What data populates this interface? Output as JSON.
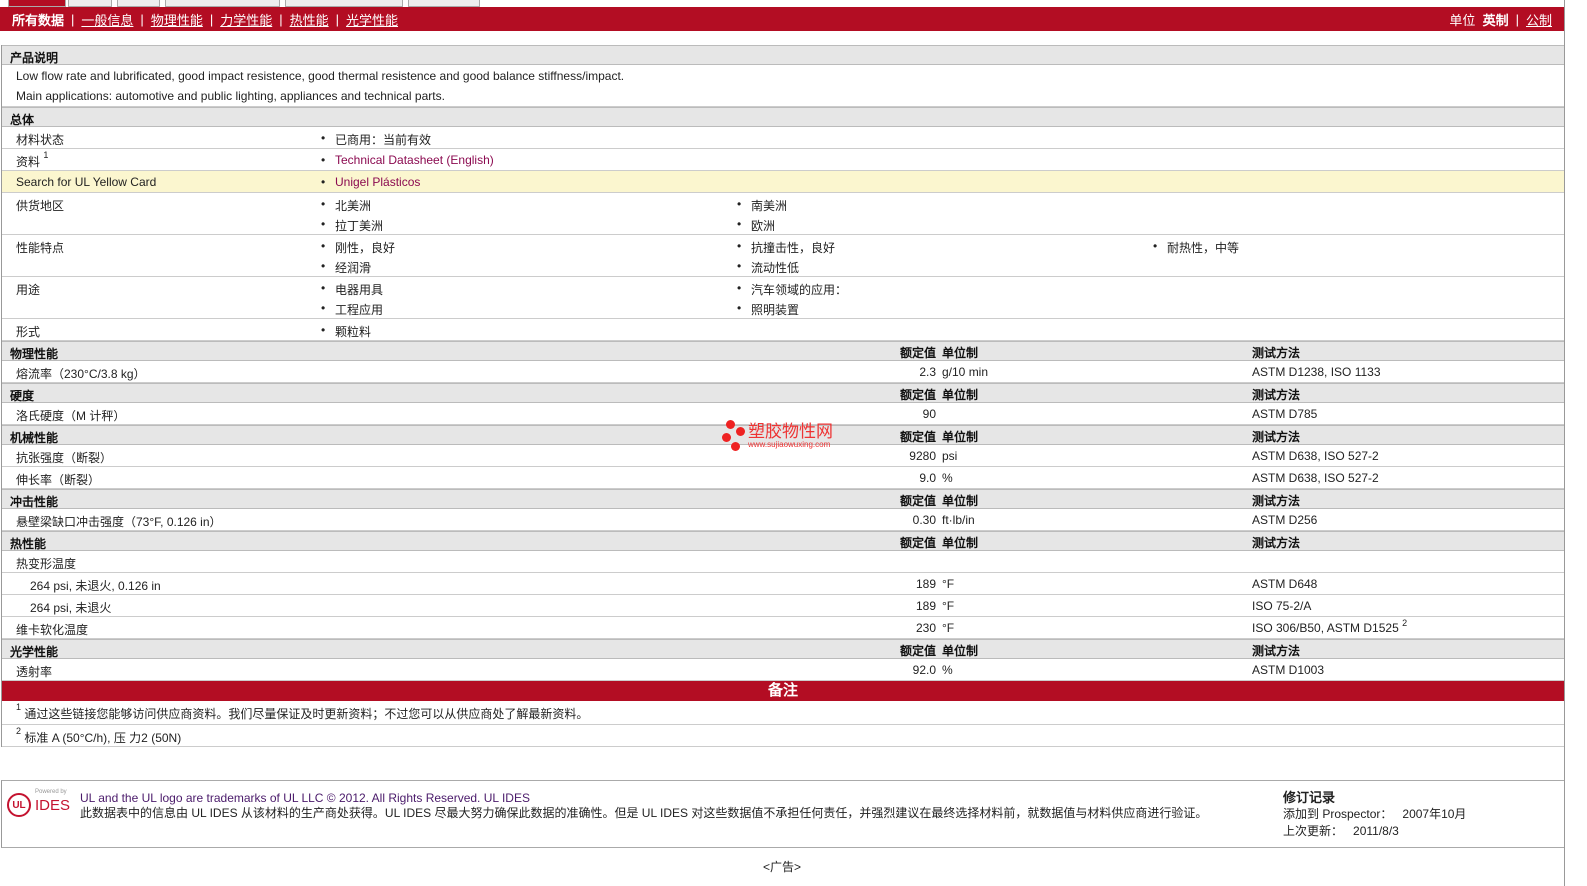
{
  "nav": {
    "all": "所有数据",
    "tabs": [
      "一般信息",
      "物理性能",
      "力学性能",
      "热性能",
      "光学性能"
    ],
    "units_label": "单位",
    "unit_selected": "英制",
    "unit_other": "公制"
  },
  "desc": {
    "title": "产品说明",
    "lines": [
      "Low flow rate and lubrificated, good impact resistence, good thermal resistence and good balance stiffness/impact.",
      "Main applications: automotive and public lighting, appliances and technical parts."
    ]
  },
  "general": {
    "title": "总体",
    "status": {
      "label": "材料状态",
      "value": "已商用：当前有效"
    },
    "docs": {
      "label": "资料",
      "sup": "1",
      "value": "Technical Datasheet (English)"
    },
    "yellow": {
      "label": "Search for UL Yellow Card",
      "value": "Unigel Plásticos"
    },
    "regions": {
      "label": "供货地区",
      "items": [
        "北美洲",
        "南美洲",
        "拉丁美洲",
        "欧洲"
      ]
    },
    "features": {
      "label": "性能特点",
      "items": [
        "刚性，良好",
        "抗撞击性，良好",
        "耐热性，中等",
        "经润滑",
        "流动性低"
      ]
    },
    "uses": {
      "label": "用途",
      "items": [
        "电器用具",
        "汽车领域的应用：",
        "工程应用",
        "照明装置"
      ]
    },
    "form": {
      "label": "形式",
      "items": [
        "颗粒料"
      ]
    }
  },
  "cols": {
    "value": "额定值",
    "unit": "单位制",
    "method": "测试方法"
  },
  "sections": {
    "physical": {
      "title": "物理性能",
      "rows": [
        {
          "name": "熔流率（230°C/3.8 kg）",
          "value": "2.3",
          "unit": "g/10 min",
          "method": "ASTM D1238, ISO 1133"
        }
      ]
    },
    "hardness": {
      "title": "硬度",
      "rows": [
        {
          "name": "洛氏硬度（M 计秤）",
          "value": "90",
          "unit": "",
          "method": "ASTM D785"
        }
      ]
    },
    "mechanical": {
      "title": "机械性能",
      "rows": [
        {
          "name": "抗张强度（断裂）",
          "value": "9280",
          "unit": "psi",
          "method": "ASTM D638, ISO 527-2"
        },
        {
          "name": "伸长率（断裂）",
          "value": "9.0",
          "unit": "%",
          "method": "ASTM D638, ISO 527-2"
        }
      ]
    },
    "impact": {
      "title": "冲击性能",
      "rows": [
        {
          "name": "悬壁梁缺口冲击强度（73°F, 0.126 in）",
          "value": "0.30",
          "unit": "ft·lb/in",
          "method": "ASTM D256"
        }
      ]
    },
    "thermal": {
      "title": "热性能",
      "hdt": "热变形温度",
      "rows": [
        {
          "name": "264 psi, 未退火, 0.126 in",
          "value": "189",
          "unit": "°F",
          "method": "ASTM D648"
        },
        {
          "name": "264 psi, 未退火",
          "value": "189",
          "unit": "°F",
          "method": "ISO 75-2/A"
        },
        {
          "name": "维卡软化温度",
          "value": "230",
          "unit": "°F",
          "method": "ISO 306/B50, ASTM D1525",
          "sup": "2"
        }
      ]
    },
    "optical": {
      "title": "光学性能",
      "rows": [
        {
          "name": "透射率",
          "value": "92.0",
          "unit": "%",
          "method": "ASTM D1003"
        }
      ]
    }
  },
  "notes": {
    "title": "备注",
    "items": [
      {
        "sup": "1",
        "text": "通过这些链接您能够访问供应商资料。我们尽量保证及时更新资料；不过您可以从供应商处了解最新资料。"
      },
      {
        "sup": "2",
        "text": "标准 A (50°C/h), 压 力2 (50N)"
      }
    ]
  },
  "footer": {
    "logo": "UL IDES",
    "powered": "Powered by",
    "line1": "UL and the UL logo are trademarks of UL LLC © 2012. All Rights Reserved. UL IDES",
    "line2": "此数据表中的信息由 UL IDES 从该材料的生产商处获得。UL IDES 尽最大努力确保此数据的准确性。但是 UL IDES 对这些数据值不承担任何责任，并强烈建议在最终选择材料前，就数据值与材料供应商进行验证。",
    "rev_title": "修订记录",
    "added_label": "添加到 Prospector：",
    "added": "2007年10月",
    "updated_label": "上次更新：",
    "updated": "2011/8/3"
  },
  "ad": "<广告>",
  "watermark": {
    "text": "塑胶物性网",
    "url": "www.sujiaowuxing.com"
  },
  "colors": {
    "brand": "#b30d23",
    "link": "#8b0a50",
    "highlight": "#fbf6cf"
  }
}
